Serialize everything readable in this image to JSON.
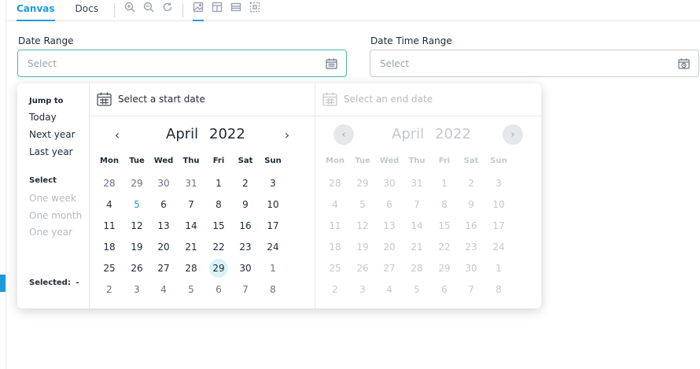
{
  "toolbar": {
    "tabs": [
      {
        "label": "Canvas",
        "active": true
      },
      {
        "label": "Docs",
        "active": false
      }
    ],
    "icons": [
      "zoom-in-icon",
      "zoom-out-icon",
      "reset-zoom-icon",
      "image-icon",
      "layout-icon",
      "grid-icon",
      "frame-icon"
    ],
    "accent": "#1e9bd7"
  },
  "date_range": {
    "label": "Date Range",
    "placeholder": "Select"
  },
  "date_time_range": {
    "label": "Date Time Range",
    "placeholder": "Select"
  },
  "popup": {
    "jump_heading": "Jump to",
    "jump_options": [
      "Today",
      "Next year",
      "Last year"
    ],
    "select_heading": "Select",
    "select_options": [
      "One week",
      "One month",
      "One year"
    ],
    "selected_label": "Selected:",
    "selected_value": "-",
    "start": {
      "title": "Select a start date",
      "month": "April",
      "year": "2022",
      "prev": "‹",
      "next": "›"
    },
    "end": {
      "title": "Select an end date",
      "month": "April",
      "year": "2022",
      "prev": "‹",
      "next": "›"
    },
    "weekdays": [
      "Mon",
      "Tue",
      "Wed",
      "Thu",
      "Fri",
      "Sat",
      "Sun"
    ],
    "weeks": [
      [
        "28",
        "29",
        "30",
        "31",
        "1",
        "2",
        "3"
      ],
      [
        "4",
        "5",
        "6",
        "7",
        "8",
        "9",
        "10"
      ],
      [
        "11",
        "12",
        "13",
        "14",
        "15",
        "16",
        "17"
      ],
      [
        "18",
        "19",
        "20",
        "21",
        "22",
        "23",
        "24"
      ],
      [
        "25",
        "26",
        "27",
        "28",
        "29",
        "30",
        "1"
      ],
      [
        "2",
        "3",
        "4",
        "5",
        "6",
        "7",
        "8"
      ]
    ],
    "today": "5",
    "highlighted": "29"
  }
}
